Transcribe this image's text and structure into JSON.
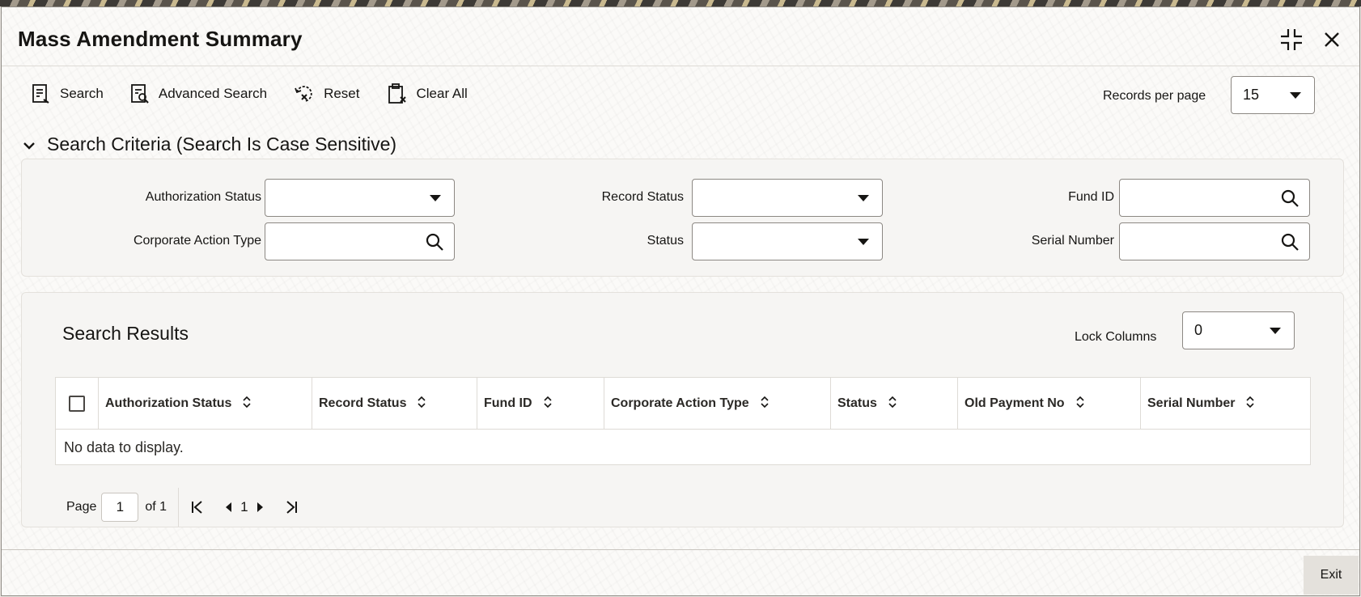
{
  "window": {
    "title": "Mass Amendment Summary"
  },
  "toolbar": {
    "search_label": "Search",
    "advanced_search_label": "Advanced Search",
    "reset_label": "Reset",
    "clear_all_label": "Clear All",
    "records_per_page_label": "Records per page",
    "records_per_page_value": "15"
  },
  "criteria": {
    "heading": "Search Criteria (Search Is Case Sensitive)",
    "fields": {
      "authorization_status": {
        "label": "Authorization Status",
        "value": ""
      },
      "record_status": {
        "label": "Record Status",
        "value": ""
      },
      "fund_id": {
        "label": "Fund ID",
        "value": ""
      },
      "corporate_action_type": {
        "label": "Corporate Action Type",
        "value": ""
      },
      "status": {
        "label": "Status",
        "value": ""
      },
      "serial_number": {
        "label": "Serial Number",
        "value": ""
      }
    }
  },
  "results": {
    "heading": "Search Results",
    "lock_columns_label": "Lock Columns",
    "lock_columns_value": "0",
    "columns": [
      "Authorization Status",
      "Record Status",
      "Fund ID",
      "Corporate Action Type",
      "Status",
      "Old Payment No",
      "Serial Number"
    ],
    "empty_text": "No data to display."
  },
  "pagination": {
    "page_label": "Page",
    "current_page": "1",
    "of_label": "of 1",
    "page_number": "1"
  },
  "footer": {
    "exit_label": "Exit"
  }
}
